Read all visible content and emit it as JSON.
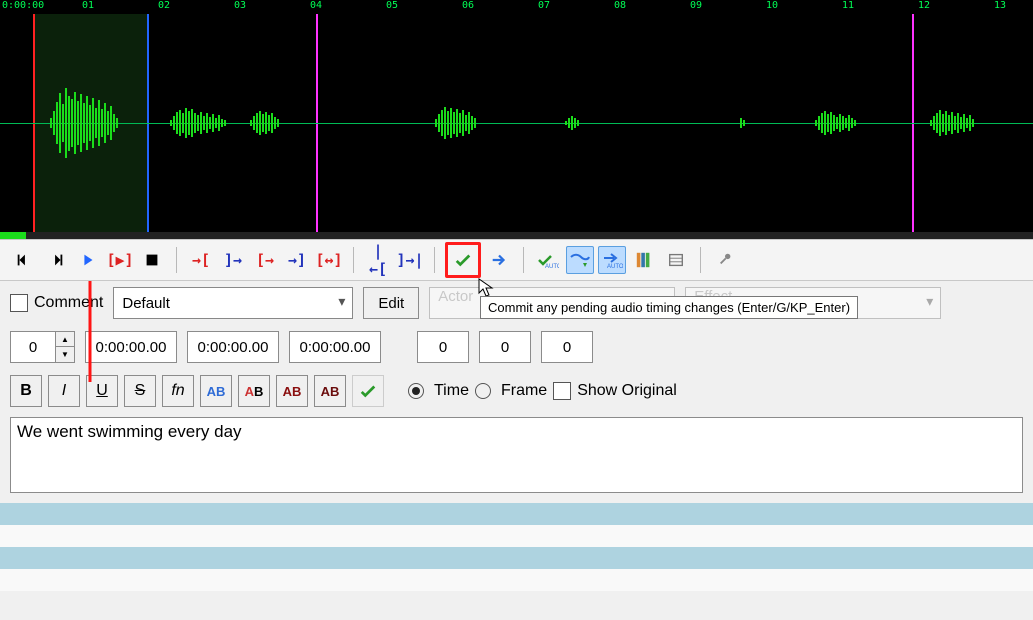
{
  "ruler": {
    "ticks": [
      "0:00:00",
      "01",
      "02",
      "03",
      "04",
      "05",
      "06",
      "07",
      "08",
      "09",
      "10",
      "11",
      "12",
      "13"
    ]
  },
  "markers": {
    "selection_start": 33,
    "selection_end": 147,
    "magenta": [
      316,
      912
    ]
  },
  "toolbar": {
    "tooltip": "Commit any pending audio timing changes (Enter/G/KP_Enter)"
  },
  "controls": {
    "comment_label": "Comment",
    "style_value": "Default",
    "edit_label": "Edit",
    "actor_placeholder": "Actor",
    "effect_placeholder": "Effect"
  },
  "times": {
    "layer": "0",
    "start": "0:00:00.00",
    "end": "0:00:00.00",
    "duration": "0:00:00.00",
    "margin_l": "0",
    "margin_r": "0",
    "margin_v": "0"
  },
  "format_row": {
    "colors": {
      "a": "#2e6bd6",
      "b": "#cc7a00",
      "c": "#8a0e0e",
      "d": "#6a0c0c"
    },
    "time_label": "Time",
    "frame_label": "Frame",
    "show_original_label": "Show Original"
  },
  "editor": {
    "text": "We went swimming every day"
  }
}
